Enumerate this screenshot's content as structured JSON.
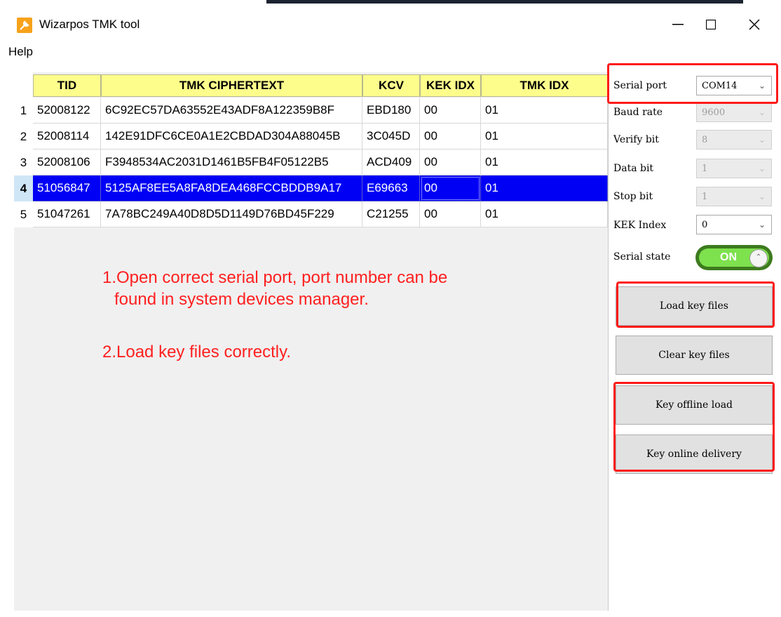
{
  "window": {
    "title": "Wizarpos TMK tool"
  },
  "menu": {
    "help": "Help"
  },
  "table": {
    "headers": [
      "TID",
      "TMK CIPHERTEXT",
      "KCV",
      "KEK IDX",
      "TMK IDX"
    ],
    "rows": [
      {
        "num": "1",
        "cells": [
          "52008122",
          "6C92EC57DA63552E43ADF8A122359B8F",
          "EBD180",
          "00",
          "01"
        ]
      },
      {
        "num": "2",
        "cells": [
          "52008114",
          "142E91DFC6CE0A1E2CBDAD304A88045B",
          "3C045D",
          "00",
          "01"
        ]
      },
      {
        "num": "3",
        "cells": [
          "52008106",
          "F3948534AC2031D1461B5FB4F05122B5",
          "ACD409",
          "00",
          "01"
        ]
      },
      {
        "num": "4",
        "cells": [
          "51056847",
          "5125AF8EE5A8FA8DEA468FCCBDDB9A17",
          "E69663",
          "00",
          "01"
        ]
      },
      {
        "num": "5",
        "cells": [
          "51047261",
          "7A78BC249A40D8D5D1149D76BD45F229",
          "C21255",
          "00",
          "01"
        ]
      }
    ],
    "selected_row": 4
  },
  "notes": {
    "line1a": "1.Open correct serial port, port number can be",
    "line1b": "found in system devices manager.",
    "line2": "2.Load key files correctly."
  },
  "settings": {
    "serial_port_label": "Serial port",
    "serial_port_value": "COM14",
    "baud_rate_label": "Baud rate",
    "baud_rate_value": "9600",
    "verify_bit_label": "Verify bit",
    "verify_bit_value": "8",
    "data_bit_label": "Data bit",
    "data_bit_value": "1",
    "stop_bit_label": "Stop bit",
    "stop_bit_value": "1",
    "kek_index_label": "KEK Index",
    "kek_index_value": "0",
    "serial_state_label": "Serial state",
    "serial_state_value": "ON"
  },
  "buttons": {
    "load": "Load key files",
    "clear": "Clear key files",
    "offline": "Key offline load",
    "online": "Key online delivery"
  },
  "colors": {
    "annotation": "#ff1a1a",
    "selection": "#0000f5",
    "header": "#fdfd8c",
    "toggle_on": "#7ee14e"
  }
}
